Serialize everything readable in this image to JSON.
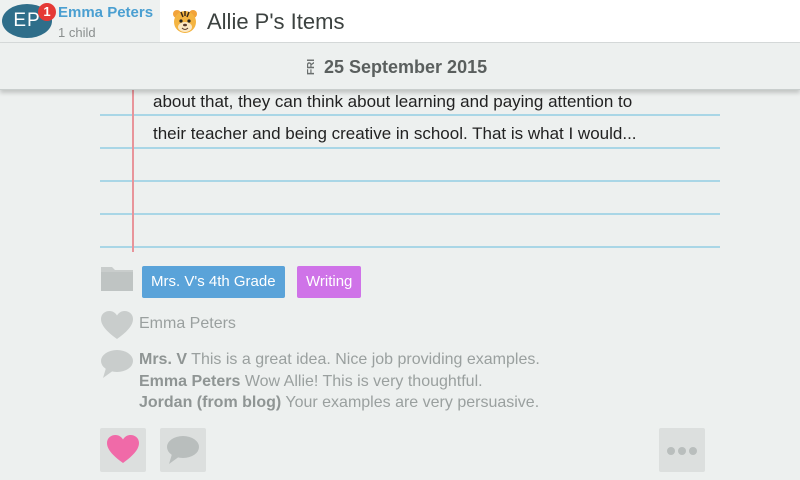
{
  "account": {
    "initials": "EP",
    "notification_count": "1",
    "name": "Emma Peters",
    "subtitle": "1 child"
  },
  "header": {
    "title": "Allie P's Items",
    "icon": "tiger-icon"
  },
  "date": {
    "day_of_week": "FRI",
    "date": "25 September 2015"
  },
  "post": {
    "lines": [
      "about that, they can think about learning and paying attention to",
      "their teacher and being creative in school. That is what I would..."
    ]
  },
  "tags": {
    "folder_icon": "folder-icon",
    "items": [
      {
        "label": "Mrs. V's 4th Grade",
        "color": "#5aa3d9"
      },
      {
        "label": "Writing",
        "color": "#cf73e8"
      }
    ]
  },
  "likes": {
    "icon": "heart-outline-icon",
    "names": "Emma Peters"
  },
  "comments": {
    "icon": "speech-bubble-icon",
    "items": [
      {
        "author": "Mrs. V",
        "text": "This is a great idea. Nice job providing examples."
      },
      {
        "author": "Emma Peters",
        "text": "Wow Allie! This is very thoughtful."
      },
      {
        "author": "Jordan (from blog)",
        "text": "Your examples are very persuasive."
      }
    ]
  },
  "actions": {
    "like_icon": "heart-icon",
    "comment_icon": "speech-bubble-icon",
    "more_icon": "more-dots-icon",
    "like_color": "#f06aa8"
  }
}
